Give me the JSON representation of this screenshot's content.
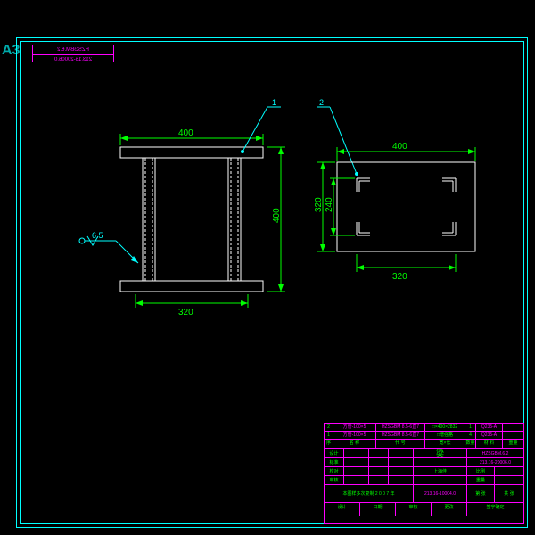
{
  "sheet_size": "A3",
  "stamp": {
    "l1": "HZSGBM.6.2",
    "l2": "213.16-20006.0"
  },
  "leaders": {
    "l1": "1",
    "l2": "2"
  },
  "dims": {
    "top_left": "400",
    "bottom_left": "320",
    "height_left": "400",
    "top_right": "400",
    "bottom_right": "320",
    "h1_right": "320",
    "h2_right": "240"
  },
  "weld": "6.5",
  "bom": [
    {
      "n": "2",
      "name": "方管-100×5",
      "dwg": "HZSGBM 8.5-6直7",
      "size": "□×400×2832",
      "qty": "1",
      "mat": "Q235-A",
      "wt": ""
    },
    {
      "n": "1",
      "name": "方管-100×5",
      "dwg": "HZSGBM 8.5-6直7",
      "size": "□增强格",
      "qty": "4",
      "mat": "Q235-A",
      "wt": ""
    }
  ],
  "bom_hdr": {
    "n": "序号",
    "name": "名 称",
    "dwg": "代 号",
    "size": "宽×长",
    "qty": "数量",
    "mat": "材 料",
    "wt": "重量"
  },
  "tb": {
    "drawn": "设计",
    "date": "日期",
    "chk": "审核",
    "appr": "批准",
    "title": "梁",
    "unit": "上海佳",
    "dwgno": "HZSGBM.6.2",
    "code": "213.16-20006.0",
    "oldcode": "213.16-10004.0",
    "scale": "比例",
    "sht": "第 张",
    "shts": "共 张",
    "wt_lbl": "重量",
    "r1": "设计",
    "r2": "标准",
    "r3": "校对",
    "r4": "审核",
    "r5": "工艺"
  }
}
